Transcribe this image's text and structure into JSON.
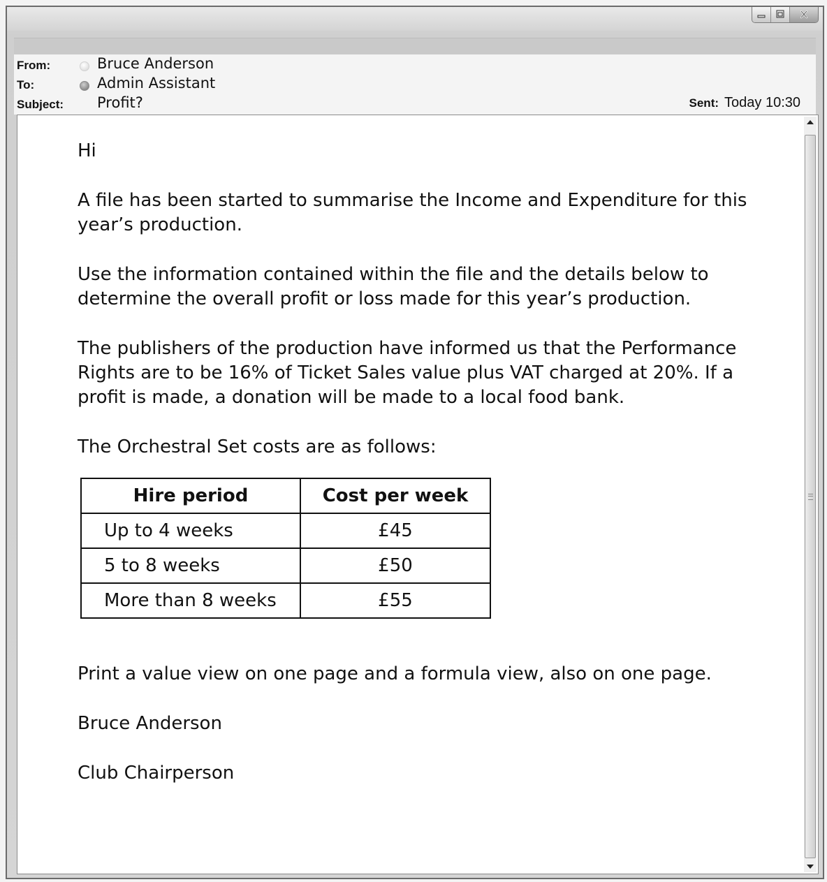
{
  "email": {
    "from_label": "From:",
    "from_value": "Bruce Anderson",
    "to_label": "To:",
    "to_value": "Admin Assistant",
    "subject_label": "Subject:",
    "subject_value": "Profit?",
    "sent_label": "Sent:",
    "sent_value": "Today 10:30"
  },
  "body": {
    "greeting": "Hi",
    "paragraph1": "A file has been started to summarise the Income and Expenditure for this year’s production.",
    "paragraph2": "Use the information contained within the file and the details below to determine the overall profit or loss made for this year’s production.",
    "paragraph3": "The publishers of the production have informed us that the Performance Rights are to be 16% of Ticket Sales value plus VAT charged at 20%. If a profit is made, a donation will be made to a local food bank.",
    "paragraph4": "The Orchestral Set costs are as follows:",
    "table": {
      "headers": [
        "Hire period",
        "Cost per week"
      ],
      "rows": [
        [
          "Up to 4 weeks",
          "£45"
        ],
        [
          "5 to 8 weeks",
          "£50"
        ],
        [
          "More than 8 weeks",
          "£55"
        ]
      ]
    },
    "paragraph5": "Print a value view on one page and a formula view, also on one page.",
    "signature_name": "Bruce Anderson",
    "signature_title": "Club Chairperson"
  },
  "icons": {
    "from_status": "presence-offline-icon",
    "to_status": "presence-icon",
    "minimize": "minimize-icon",
    "maximize": "maximize-icon",
    "close": "close-icon",
    "scroll_up": "scroll-up-arrow-icon",
    "scroll_down": "scroll-down-arrow-icon"
  }
}
